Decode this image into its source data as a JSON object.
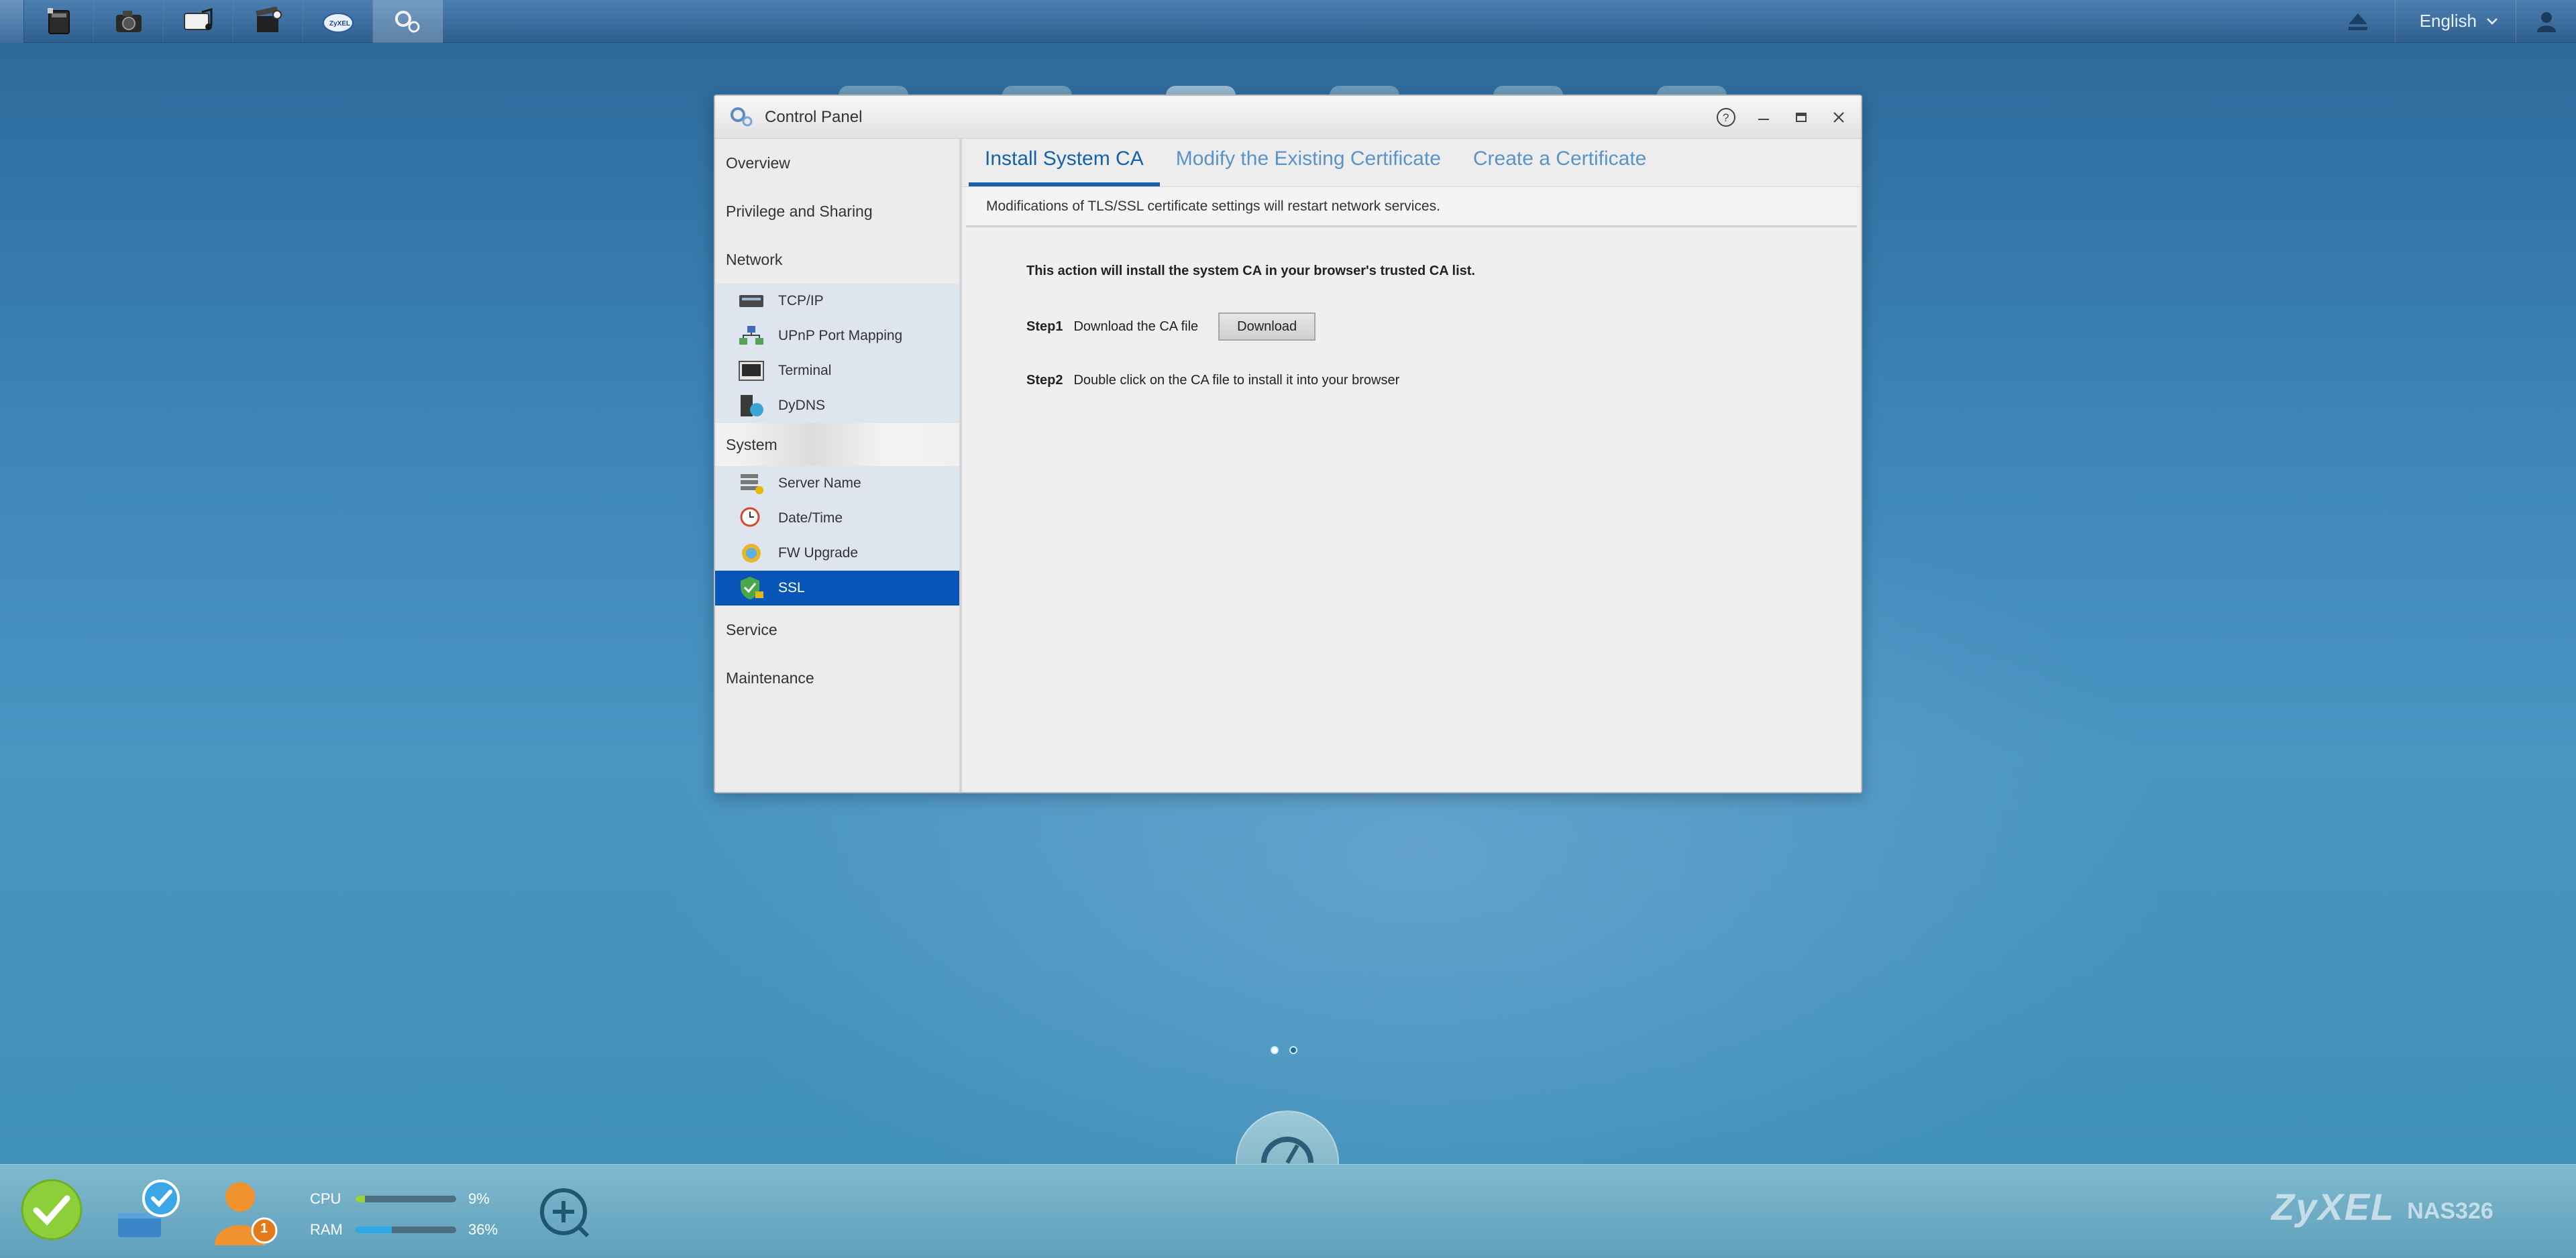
{
  "topbar": {
    "apps": [
      {
        "icon": "file-browser-icon",
        "active": false
      },
      {
        "icon": "photo-icon",
        "active": false
      },
      {
        "icon": "music-icon",
        "active": false
      },
      {
        "icon": "video-icon",
        "active": false
      },
      {
        "icon": "zyxel-cloud-icon",
        "active": false
      },
      {
        "icon": "control-panel-icon",
        "active": true
      }
    ],
    "language": "English"
  },
  "window": {
    "title": "Control Panel",
    "sidebar": {
      "overview": "Overview",
      "privilege": "Privilege and Sharing",
      "network": "Network",
      "network_items": [
        "TCP/IP",
        "UPnP Port Mapping",
        "Terminal",
        "DyDNS"
      ],
      "system": "System",
      "system_items": [
        "Server Name",
        "Date/Time",
        "FW Upgrade",
        "SSL"
      ],
      "service": "Service",
      "maintenance": "Maintenance",
      "selected": "SSL"
    },
    "tabs": [
      "Install System CA",
      "Modify the Existing Certificate",
      "Create a Certificate"
    ],
    "active_tab": "Install System CA",
    "notice": "Modifications of TLS/SSL certificate settings will restart network services.",
    "panel": {
      "lead": "This action will install the system CA in your browser's trusted CA list.",
      "step1_label": "Step1",
      "step1_text": "Download the CA file",
      "download_button": "Download",
      "step2_label": "Step2",
      "step2_text": "Double click on the CA file to install it into your browser"
    }
  },
  "bottombar": {
    "cpu_label": "CPU",
    "cpu_value": "9%",
    "cpu_fraction": 0.09,
    "ram_label": "RAM",
    "ram_value": "36%",
    "ram_fraction": 0.36,
    "notification_count": "1",
    "brand": "ZyXEL",
    "model": "NAS326"
  },
  "colors": {
    "accent": "#0a56b8",
    "tab_active": "#1761a6",
    "tab_inactive": "#5a93c8",
    "cpu_bar": "#9ad23c",
    "ram_bar": "#2ea8e6"
  }
}
